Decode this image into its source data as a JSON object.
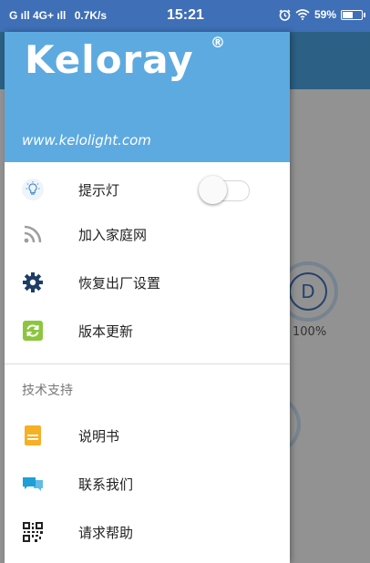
{
  "status_bar": {
    "signal_text": "G ıll 4G+ ıll",
    "speed": "0.7K/s",
    "time": "15:21",
    "battery": "59%",
    "battery_level": 0.59
  },
  "background": {
    "dial_letter": "D",
    "percent": "100%"
  },
  "drawer": {
    "brand": "Keloray",
    "reg_mark": "®",
    "website": "www.kelolight.com",
    "items": [
      {
        "label": "提示灯",
        "icon": "bulb-icon"
      },
      {
        "label": "加入家庭网",
        "icon": "rss-icon"
      },
      {
        "label": "恢复出厂设置",
        "icon": "gear-icon"
      },
      {
        "label": "版本更新",
        "icon": "refresh-icon"
      }
    ],
    "indicator_toggle_on": false,
    "section_title": "技术支持",
    "support_items": [
      {
        "label": "说明书",
        "icon": "manual-icon"
      },
      {
        "label": "联系我们",
        "icon": "chat-icon"
      },
      {
        "label": "请求帮助",
        "icon": "qrcode-icon"
      }
    ]
  }
}
